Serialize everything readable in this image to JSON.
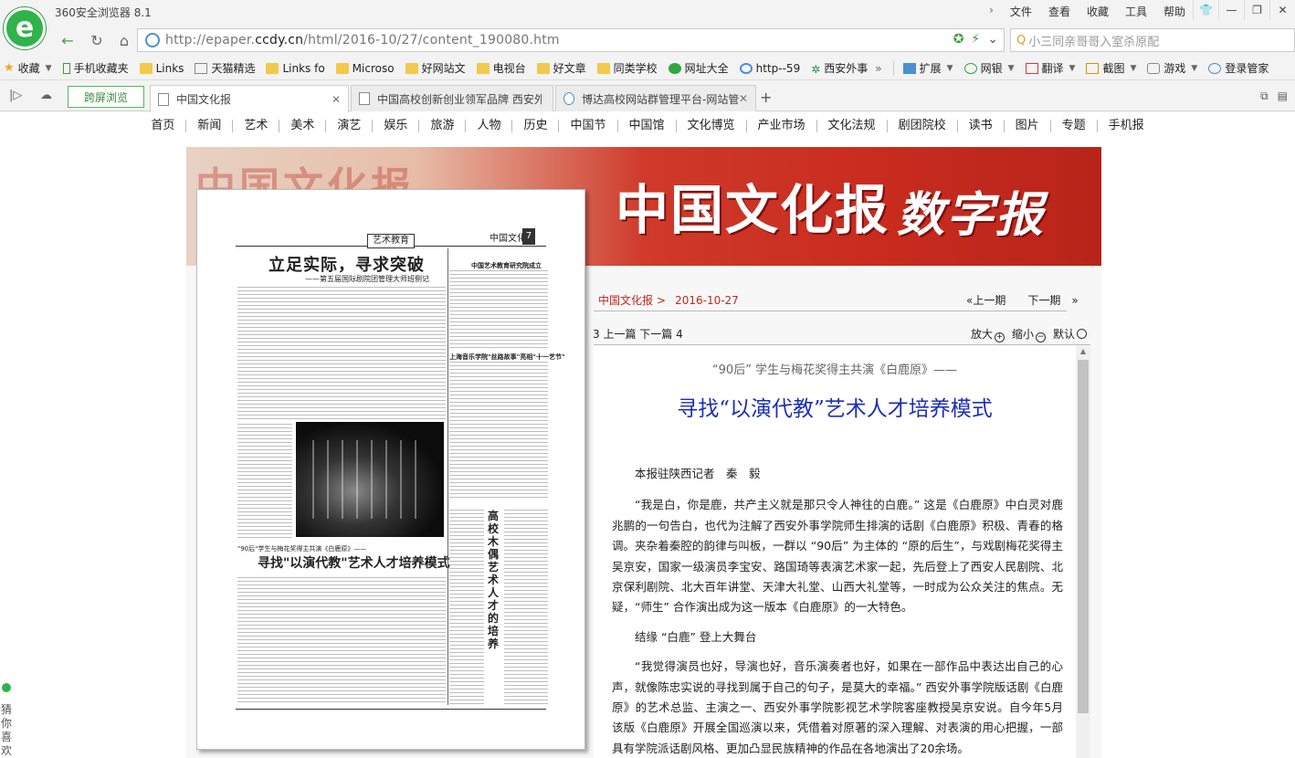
{
  "browser": {
    "app_title": "360安全浏览器 8.1",
    "menu": [
      "文件",
      "查看",
      "收藏",
      "工具",
      "帮助"
    ],
    "url_prefix": "http://epaper.",
    "url_domain": "ccdy.cn",
    "url_path": "/html/2016-10/27/content_190080.htm",
    "search_text": "小三同亲哥哥入室杀原配"
  },
  "bookmarks": {
    "items": [
      "收藏",
      "手机收藏夹",
      "Links",
      "天猫精选",
      "Links fo",
      "Microso",
      "好网站文",
      "电视台",
      "好文章",
      "同类学校",
      "网址大全",
      "http--59",
      "西安外事"
    ],
    "tools": [
      "扩展",
      "网银",
      "翻译",
      "截图",
      "游戏",
      "登录管家"
    ]
  },
  "tabs": {
    "cross_screen": "跨屏浏览",
    "items": [
      "中国文化报",
      "中国高校创新创业领军品牌 西安外",
      "博达高校网站群管理平台-网站管"
    ]
  },
  "site_nav": [
    "首页",
    "新闻",
    "艺术",
    "美术",
    "演艺",
    "娱乐",
    "旅游",
    "人物",
    "历史",
    "中国节",
    "中国馆",
    "文化博览",
    "产业市场",
    "文化法规",
    "剧团院校",
    "读书",
    "图片",
    "专题",
    "手机报"
  ],
  "banner": {
    "title": "中国文化报",
    "subtitle": "数字报",
    "ghost": "中国文化报"
  },
  "newspaper": {
    "section": "艺术教育",
    "logo": "中国文化报",
    "page_no": "7",
    "headline": "立足实际，寻求突破",
    "headline_sub": "——第五届国际剧院团管理大师班侧记",
    "article2_sub": "\"90后\"学生与梅花奖得主共演《白鹿原》——",
    "article2_title": "寻找\"以演代教\"艺术人才培养模式",
    "vertical_title": "高校木偶艺术人才的培养",
    "right_title1": "中国艺术教育研究院成立",
    "right_title2": "上海音乐学院\"丝路故事\"亮相\"十一艺节\""
  },
  "article": {
    "breadcrumb_paper": "中国文化报",
    "breadcrumb_date": "2016-10-27",
    "prev_issue": "上一期",
    "next_issue": "下一期",
    "page_nav": "3 上一篇   下一篇 4",
    "zoom_in": "放大",
    "zoom_out": "缩小",
    "zoom_default": "默认",
    "subtitle": "“90后” 学生与梅花奖得主共演《白鹿原》——",
    "title": "寻找“以演代教”艺术人才培养模式",
    "byline": "本报驻陕西记者　秦　毅",
    "para1": "“我是白，你是鹿，共产主义就是那只令人神往的白鹿。” 这是《白鹿原》中白灵对鹿兆鹏的一句告白，也代为注解了西安外事学院师生排演的话剧《白鹿原》积极、青春的格调。夹杂着秦腔的韵律与叫板，一群以 “90后” 为主体的 “原的后生”，与戏剧梅花奖得主吴京安，国家一级演员李宝安、路国琦等表演艺术家一起，先后登上了西安人民剧院、北京保利剧院、北大百年讲堂、天津大礼堂、山西大礼堂等，一时成为公众关注的焦点。无疑，“师生” 合作演出成为这一版本《白鹿原》的一大特色。",
    "subhead": "结缘 “白鹿” 登上大舞台",
    "para2": "“我觉得演员也好，导演也好，音乐演奏者也好，如果在一部作品中表达出自己的心声，就像陈忠实说的寻找到属于自己的句子，是莫大的幸福。” 西安外事学院版话剧《白鹿原》的艺术总监、主演之一、西安外事学院影视艺术学院客座教授吴京安说。自今年5月该版《白鹿原》开展全国巡演以来，凭借着对原著的深入理解、对表演的用心把握，一部具有学院派话剧风格、更加凸显民族精神的作品在各地演出了20余场。"
  },
  "sidebar": {
    "fav_text": "猜你喜欢"
  }
}
